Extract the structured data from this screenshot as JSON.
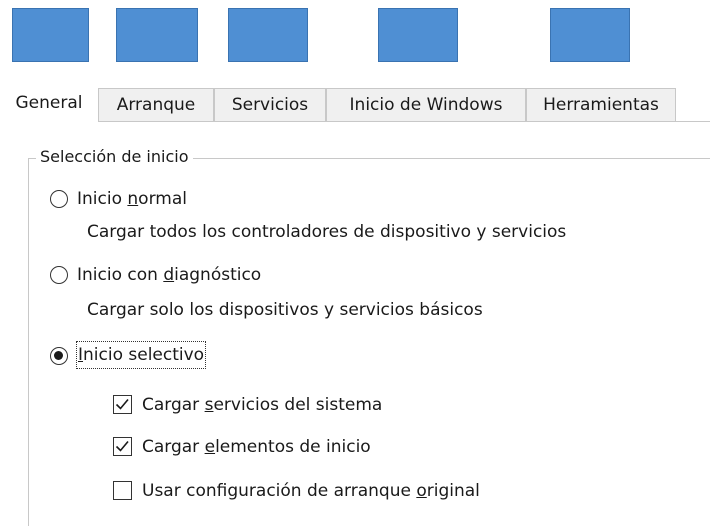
{
  "tabs": [
    {
      "label": "General",
      "active": true
    },
    {
      "label": "Arranque",
      "active": false
    },
    {
      "label": "Servicios",
      "active": false
    },
    {
      "label": "Inicio de Windows",
      "active": false
    },
    {
      "label": "Herramientas",
      "active": false
    }
  ],
  "tab_icon_color": "#4f8fd3",
  "startup_group": {
    "title": "Selección de inicio",
    "options": [
      {
        "label_pre": "Inicio ",
        "label_key": "n",
        "label_post": "ormal",
        "description": "Cargar todos los controladores de dispositivo y servicios",
        "checked": false
      },
      {
        "label_pre": "Inicio con ",
        "label_key": "d",
        "label_post": "iagnóstico",
        "description": "Cargar solo los dispositivos y servicios básicos",
        "checked": false
      },
      {
        "label_pre": "",
        "label_key": "I",
        "label_post": "nicio selectivo",
        "checked": true
      }
    ],
    "selective_options": [
      {
        "label_pre": "Cargar ",
        "label_key": "s",
        "label_post": "ervicios del sistema",
        "checked": true
      },
      {
        "label_pre": "Cargar ",
        "label_key": "e",
        "label_post": "lementos de inicio",
        "checked": true
      },
      {
        "label_pre": "Usar configuración de arranque ",
        "label_key": "o",
        "label_post": "riginal",
        "checked": false
      }
    ]
  }
}
